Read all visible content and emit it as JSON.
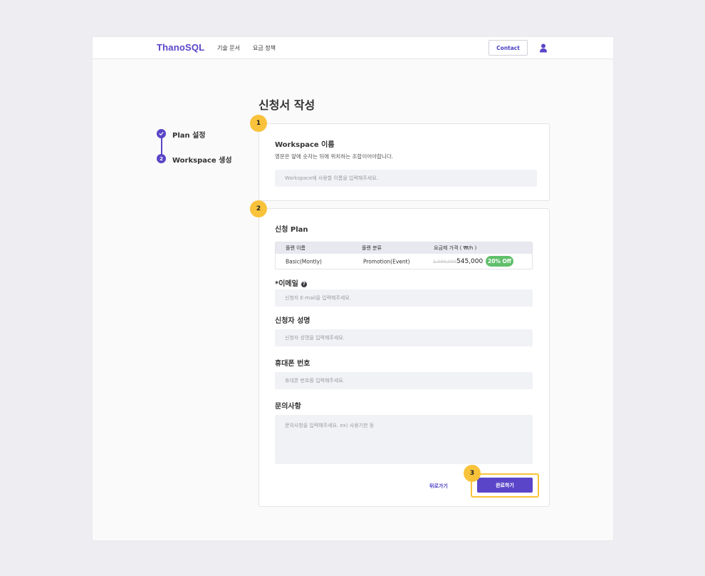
{
  "nav": {
    "logo": "ThanoSQL",
    "links": [
      "기술 문서",
      "요금 정책"
    ],
    "contact": "Contact",
    "user_icon": "user-icon"
  },
  "page": {
    "title": "신청서 작성"
  },
  "steps": [
    {
      "marker": "✓",
      "label": "Plan 설정",
      "status": "done"
    },
    {
      "marker": "2",
      "label": "Workspace 생성",
      "status": "current"
    }
  ],
  "workspace_card": {
    "badge": "1",
    "label": "Workspace 이름",
    "description": "영문은 앞에 숫자는 뒤에 위치하는 조합이어야합니다.",
    "placeholder": "Workspace에 사용할 이름을 입력해주세요."
  },
  "form_card": {
    "badge": "2",
    "plan_label": "신청 Plan",
    "plan_table": {
      "headers": [
        "플랜 이름",
        "플랜 분류",
        "요금제 가격 ( ₩/h )"
      ],
      "row": {
        "name": "Basic(Montly)",
        "category": "Promotion(Event)",
        "old_price": "1,000,000",
        "new_price": "545,000",
        "discount": "20% Off"
      }
    },
    "email": {
      "label": "*이메일",
      "help_icon": "question-icon",
      "placeholder": "신청자 E-mail을 입력해주세요."
    },
    "name": {
      "label": "신청자 성명",
      "placeholder": "신청자 성명을 입력해주세요."
    },
    "phone": {
      "label": "휴대폰 번호",
      "placeholder": "휴대폰 번호를 입력해주세요."
    },
    "inquiry": {
      "label": "문의사항",
      "placeholder": "문의사항을 입력해주세요. ex) 사용기한 등"
    },
    "back": "뒤로가기",
    "submit": "완료하기",
    "submit_badge": "3"
  },
  "colors": {
    "brand": "#5a44c8",
    "badge": "#f8c23a",
    "discount": "#5fbf6a"
  }
}
